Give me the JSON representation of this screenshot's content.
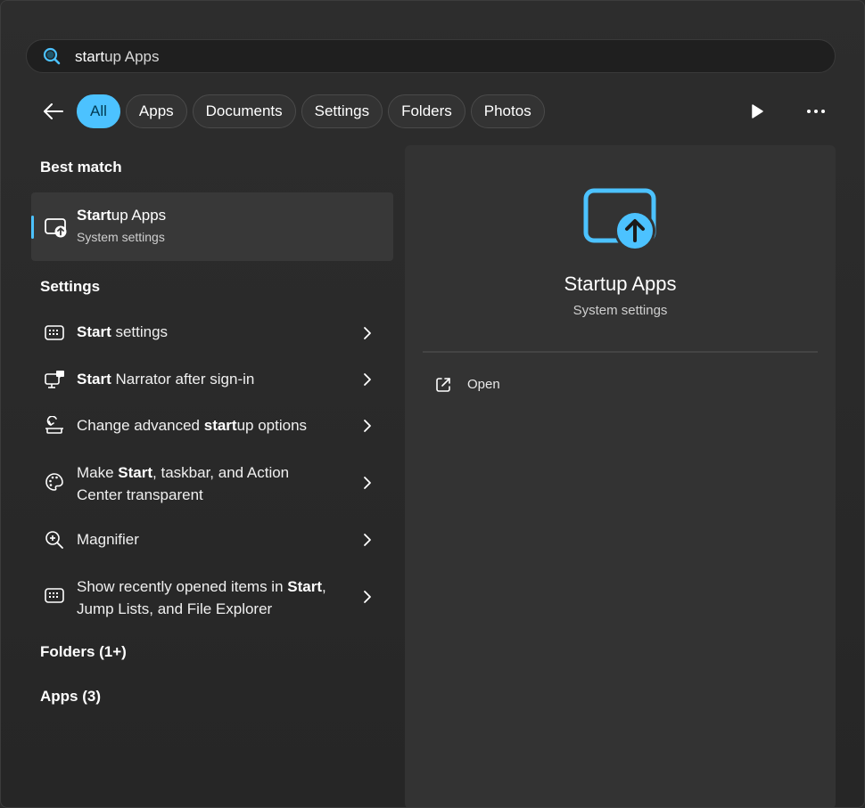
{
  "search": {
    "match": "start",
    "rest": "up Apps"
  },
  "filters": [
    "All",
    "Apps",
    "Documents",
    "Settings",
    "Folders",
    "Photos"
  ],
  "left": {
    "best_match_heading": "Best match",
    "best_match": {
      "title_bold": "Start",
      "title_rest": "up Apps",
      "subtitle": "System settings"
    },
    "settings_heading": "Settings",
    "settings_items": [
      {
        "icon": "start-settings-icon",
        "parts": [
          {
            "b": "Start"
          },
          {
            "t": " settings"
          }
        ]
      },
      {
        "icon": "narrator-icon",
        "parts": [
          {
            "b": "Start"
          },
          {
            "t": " Narrator after sign-in"
          }
        ]
      },
      {
        "icon": "advanced-startup-icon",
        "parts": [
          {
            "t": "Change advanced "
          },
          {
            "b": "start"
          },
          {
            "t": "up options"
          }
        ]
      },
      {
        "icon": "palette-icon",
        "parts": [
          {
            "t": "Make "
          },
          {
            "b": "Start"
          },
          {
            "t": ", taskbar, and Action Center transparent"
          }
        ]
      },
      {
        "icon": "magnifier-icon",
        "parts": [
          {
            "t": "Magnifier"
          }
        ]
      },
      {
        "icon": "start-settings-icon",
        "parts": [
          {
            "t": "Show recently opened items in "
          },
          {
            "b": "Start"
          },
          {
            "t": ", Jump Lists, and File Explorer"
          }
        ]
      }
    ],
    "folders_heading": "Folders (1+)",
    "apps_heading": "Apps (3)"
  },
  "preview": {
    "icon": "startup-apps-icon",
    "title": "Startup Apps",
    "subtitle": "System settings",
    "open_label": "Open",
    "open_icon": "open-external-icon"
  },
  "colors": {
    "accent": "#4cc2ff",
    "background": "#2b2b2b",
    "panel": "#333333"
  }
}
